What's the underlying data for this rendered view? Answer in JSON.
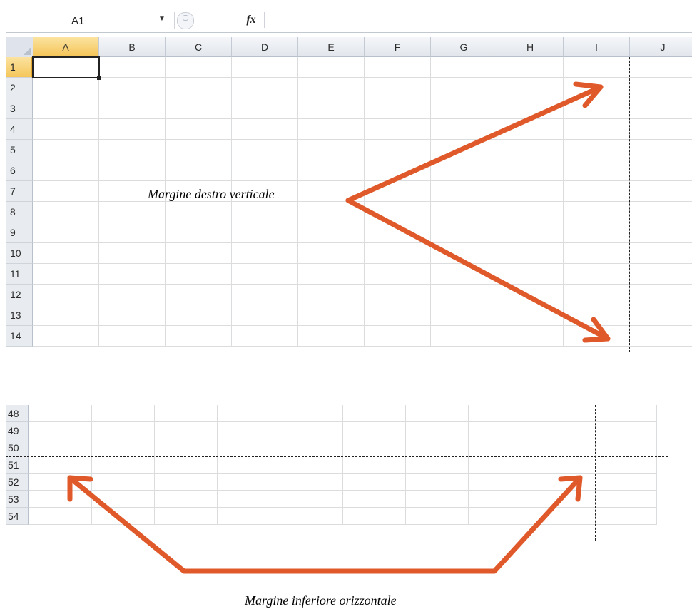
{
  "formula_bar": {
    "name_box": "A1",
    "fx_label": "fx",
    "formula_value": ""
  },
  "columns": [
    "A",
    "B",
    "C",
    "D",
    "E",
    "F",
    "G",
    "H",
    "I",
    "J"
  ],
  "rows_top": [
    "1",
    "2",
    "3",
    "4",
    "5",
    "6",
    "7",
    "8",
    "9",
    "10",
    "11",
    "12",
    "13",
    "14"
  ],
  "rows_bottom": [
    "48",
    "49",
    "50",
    "51",
    "52",
    "53",
    "54"
  ],
  "selected_cell": "A1",
  "annotations": {
    "vertical_caption": "Margine destro verticale",
    "horizontal_caption": "Margine inferiore orizzontale"
  },
  "colors": {
    "arrow": "#e0592a",
    "active_header": "#f5c65b",
    "gridline": "#dadcdd"
  }
}
